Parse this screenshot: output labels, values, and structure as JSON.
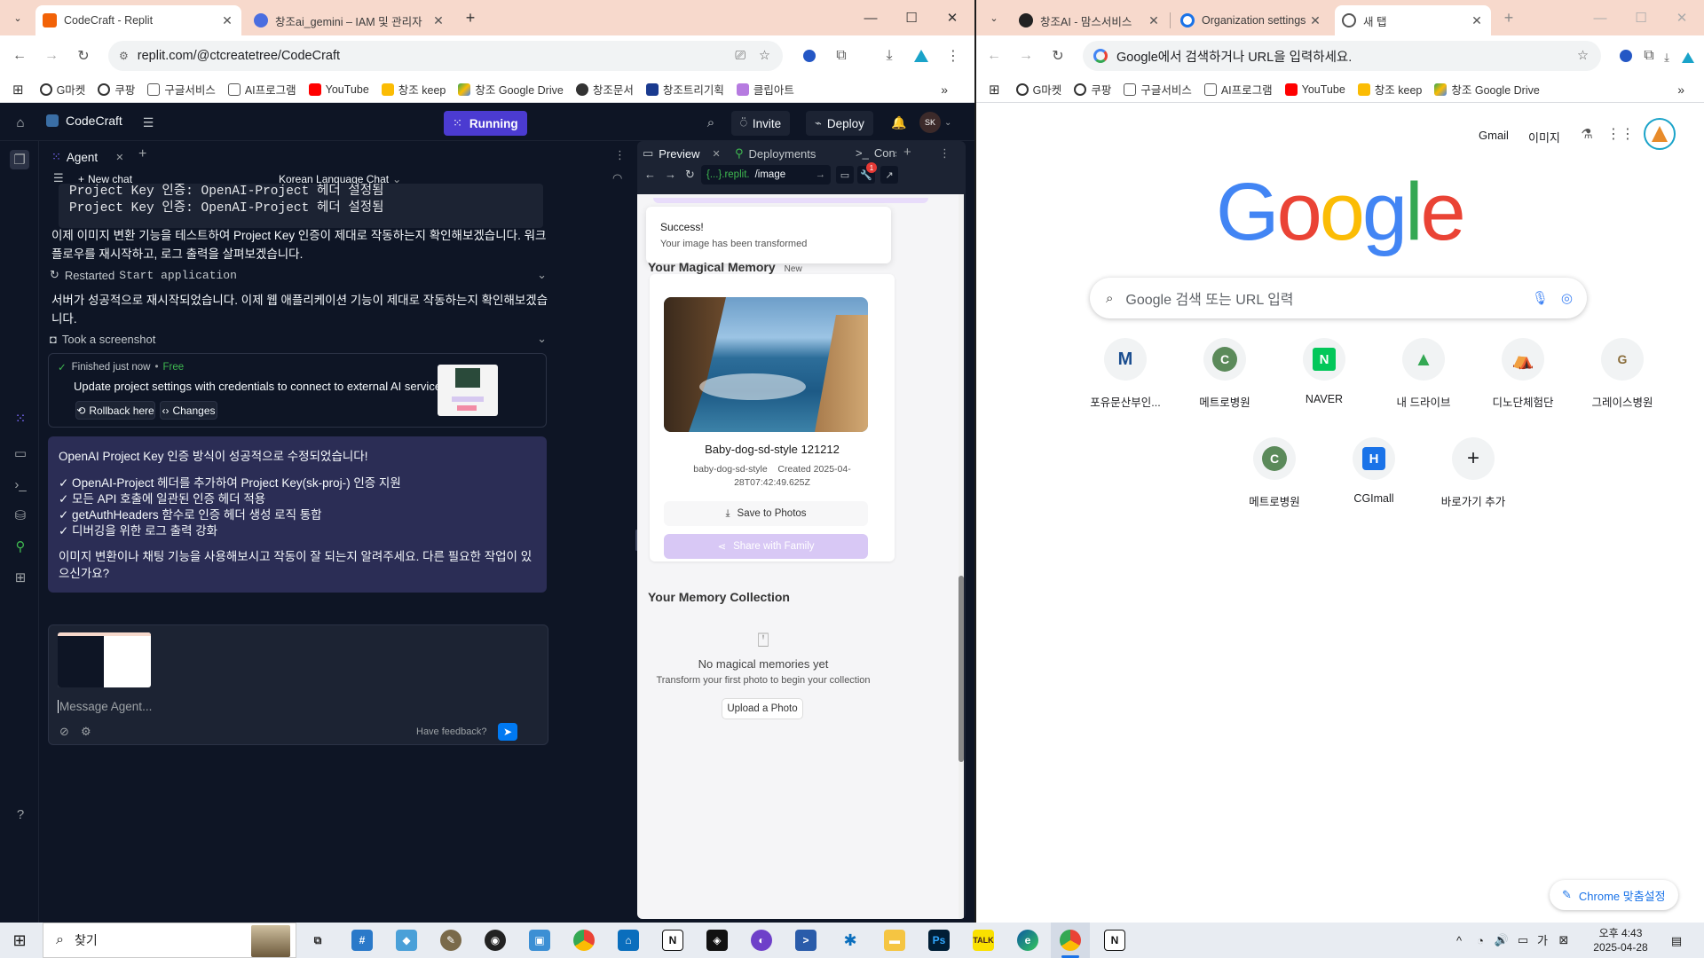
{
  "left_window": {
    "tabs": [
      {
        "title": "CodeCraft - Replit",
        "active": true
      },
      {
        "title": "창조ai_gemini – IAM 및 관리자",
        "active": false
      }
    ],
    "url": "replit.com/@ctcreatetree/CodeCraft",
    "bookmarks": [
      "G마켓",
      "쿠팡",
      "구글서비스",
      "AI프로그램",
      "YouTube",
      "창조 keep",
      "창조 Google Drive",
      "창조문서",
      "창조트리기획",
      "클립아트"
    ]
  },
  "right_window": {
    "tabs": [
      {
        "title": "창조AI - 맘스서비스",
        "active": false
      },
      {
        "title": "Organization settings",
        "active": false
      },
      {
        "title": "새 탭",
        "active": true
      }
    ],
    "omnibox_placeholder": "Google에서 검색하거나 URL을 입력하세요.",
    "bookmarks": [
      "G마켓",
      "쿠팡",
      "구글서비스",
      "AI프로그램",
      "YouTube",
      "창조 keep",
      "창조 Google Drive"
    ]
  },
  "replit": {
    "project_name": "CodeCraft",
    "run_status": "Running",
    "invite_label": "Invite",
    "deploy_label": "Deploy",
    "avatar_initials": "SK",
    "agent_tab": "Agent",
    "new_chat": "New chat",
    "chat_title": "Korean Language Chat",
    "code_lines": [
      "Project Key 인증: OpenAI-Project 헤더 설정됨",
      "Project Key 인증: OpenAI-Project 헤더 설정됨"
    ],
    "msg1": "이제 이미지 변환 기능을 테스트하여 Project Key 인증이 제대로 작동하는지 확인해보겠습니다. 워크플로우를 재시작하고, 로그 출력을 살펴보겠습니다.",
    "action1_prefix": "Restarted",
    "action1_code": "Start application",
    "msg2": "서버가 성공적으로 재시작되었습니다. 이제 웹 애플리케이션 기능이 제대로 작동하는지 확인해보겠습니다.",
    "action2": "Took a screenshot",
    "checkpoint": {
      "status": "Finished just now",
      "plan": "Free",
      "title": "Update project settings with credentials to connect to external AI services",
      "rollback": "Rollback here",
      "changes": "Changes"
    },
    "final_message": {
      "heading": "OpenAI Project Key 인증 방식이 성공적으로 수정되었습니다!",
      "bullets": [
        "✓ OpenAI-Project 헤더를 추가하여 Project Key(sk-proj-) 인증 지원",
        "✓ 모든 API 호출에 일관된 인증 헤더 적용",
        "✓ getAuthHeaders 함수로 인증 헤더 생성 로직 통합",
        "✓ 디버깅을 위한 로그 출력 강화"
      ],
      "closing": "이미지 변환이나 채팅 기능을 사용해보시고 작동이 잘 되는지 알려주세요. 다른 필요한 작업이 있으신가요?"
    },
    "input_placeholder": "Message Agent...",
    "feedback": "Have feedback?",
    "preview_tabs": [
      "Preview",
      "Deployments",
      "Console"
    ],
    "preview_url_host": "{...}.replit.",
    "preview_url_path": "/image",
    "notification_count": "1",
    "toast": {
      "title": "Success!",
      "body": "Your image has been transformed"
    },
    "memory_heading": "Your Magical Memory",
    "memory_badge": "New",
    "memory_card": {
      "title": "Baby-dog-sd-style 121212",
      "style": "baby-dog-sd-style",
      "created_line1": "Created 2025-04-",
      "created_line2": "28T07:42:49.625Z",
      "save": "Save to Photos",
      "share": "Share with Family"
    },
    "collection_heading": "Your Memory Collection",
    "empty_title": "No magical memories yet",
    "empty_body": "Transform your first photo to begin your collection",
    "upload": "Upload a Photo"
  },
  "google": {
    "gmail": "Gmail",
    "images": "이미지",
    "search_placeholder": "Google 검색 또는 URL 입력",
    "shortcuts": [
      {
        "label": "포유문산부인...",
        "letter": "M",
        "color": "#1a4d8f"
      },
      {
        "label": "메트로병원",
        "letter": "C",
        "color": "#5b8a5a"
      },
      {
        "label": "NAVER",
        "letter": "N",
        "color": "#03c75a"
      },
      {
        "label": "내 드라이브",
        "letter": "▲",
        "color": "#4285f4"
      },
      {
        "label": "디노단체험단",
        "letter": "⛺",
        "color": "#3a9b3a"
      },
      {
        "label": "그레이스병원",
        "letter": "G",
        "color": "#8a6d3b"
      },
      {
        "label": "메트로병원",
        "letter": "C",
        "color": "#5b8a5a"
      },
      {
        "label": "CGImall",
        "letter": "H",
        "color": "#1a73e8"
      },
      {
        "label": "바로가기 추가",
        "letter": "+",
        "color": "#202124"
      }
    ],
    "customize": "Chrome 맞춤설정"
  },
  "taskbar": {
    "search_label": "찾기",
    "time": "오후 4:43",
    "date": "2025-04-28",
    "ime": "가"
  }
}
